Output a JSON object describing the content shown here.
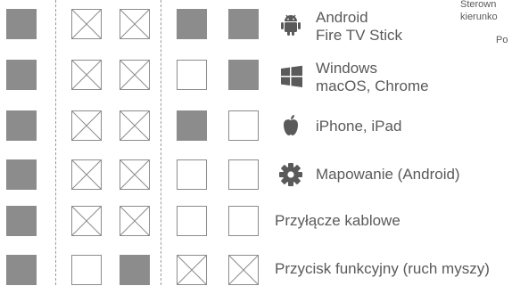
{
  "rows": [
    {
      "cells": [
        "filled",
        "cross",
        "cross",
        "filled",
        "filled"
      ],
      "icon": "android-icon",
      "lines": [
        "Android",
        "Fire TV Stick"
      ]
    },
    {
      "cells": [
        "filled",
        "cross",
        "cross",
        "empty",
        "filled"
      ],
      "icon": "windows-icon",
      "lines": [
        "Windows",
        "macOS, Chrome"
      ]
    },
    {
      "cells": [
        "filled",
        "cross",
        "cross",
        "filled",
        "empty"
      ],
      "icon": "apple-icon",
      "lines": [
        "iPhone, iPad"
      ]
    },
    {
      "cells": [
        "filled",
        "cross",
        "cross",
        "empty",
        "empty"
      ],
      "icon": "gear-icon",
      "lines": [
        "Mapowanie (Android)"
      ]
    },
    {
      "cells": [
        "filled",
        "cross",
        "cross",
        "empty",
        "empty"
      ],
      "icon": "",
      "lines": [
        "Przyłącze kablowe"
      ]
    },
    {
      "cells": [
        "filled",
        "empty",
        "filled",
        "cross",
        "cross"
      ],
      "icon": "",
      "lines": [
        "Przycisk funkcyjny (ruch myszy)"
      ]
    }
  ],
  "corner": {
    "line1": "Sterown",
    "line2": "kierunko",
    "line3": "Po"
  },
  "colors": {
    "cell": "#8c8c8c",
    "text": "#5a5a5a"
  }
}
